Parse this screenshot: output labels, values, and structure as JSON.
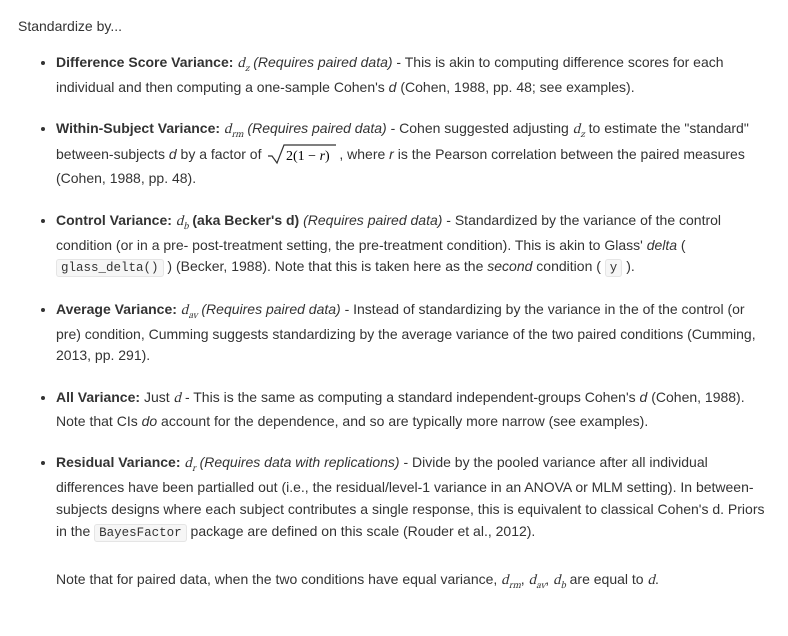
{
  "lead": "Standardize by...",
  "items": [
    {
      "title": "Difference Score Variance:",
      "symbol_html": "<span class='math'>d<span class='sub'>z</span></span>",
      "req": "(Requires paired data)",
      "body_html": " - This is akin to computing difference scores for each individual and then computing a one-sample Cohen's <em>d</em> (Cohen, 1988, pp. 48; see examples)."
    },
    {
      "title": "Within-Subject Variance:",
      "symbol_html": "<span class='math'>d<span class='sub'>rm</span></span>",
      "req": "(Requires paired data)",
      "body_html": " - Cohen suggested adjusting <span class='math'>d<span class='sub'>z</span></span> to estimate the &quot;standard&quot; between-subjects <em>d</em> by a factor of <span class='sqrt-wrap'><svg width='70' height='22' viewBox='0 0 70 22' style='vertical-align:-4px' xmlns='http://www.w3.org/2000/svg'><path d='M1 13 L5 13 L10 20 L17 2 L69 2' fill='none' stroke='#333' stroke-width='1.2'/><text x='19' y='17' font-family=\"Georgia,serif\" font-size='14'>2(1 − <tspan font-style='italic'>r</tspan>)</text></svg></span>, where <em>r</em> is the Pearson correlation between the paired measures (Cohen, 1988, pp. 48)."
    },
    {
      "title": "Control Variance:",
      "symbol_html": "<span class='math'>d<span class='sub'>b</span></span>",
      "aka": "(aka Becker's d)",
      "req": "(Requires paired data)",
      "body_html": " - Standardized by the variance of the control condition (or in a pre- post-treatment setting, the pre-treatment condition). This is akin to Glass' <em>delta</em> ( <code>glass_delta()</code> ) (Becker, 1988). Note that this is taken here as the <em>second</em> condition ( <code>y</code> )."
    },
    {
      "title": "Average Variance:",
      "symbol_html": "<span class='math'>d<span class='sub'>av</span></span>",
      "req": "(Requires paired data)",
      "body_html": " - Instead of standardizing by the variance in the of the control (or pre) condition, Cumming suggests standardizing by the average variance of the two paired conditions (Cumming, 2013, pp. 291)."
    },
    {
      "title": "All Variance:",
      "prefix": "Just ",
      "symbol_html": "<span class='math'>d</span>",
      "body_html": " - This is the same as computing a standard independent-groups Cohen's <em>d</em> (Cohen, 1988). Note that CIs <em>do</em> account for the dependence, and so are typically more narrow (see examples)."
    },
    {
      "title": "Residual Variance:",
      "symbol_html": "<span class='math'>d<span class='sub'>r</span></span>",
      "req": "(Requires data with replications)",
      "body_html": " - Divide by the pooled variance after all individual differences have been partialled out (i.e., the residual/level-1 variance in an ANOVA or MLM setting). In between-subjects designs where each subject contributes a single response, this is equivalent to classical Cohen's d. Priors in the <code>BayesFactor</code> package are defined on this scale (Rouder et al., 2012).",
      "note_html": "Note that for paired data, when the two conditions have equal variance, <span class='math'>d<span class='sub'>rm</span></span>, <span class='math'>d<span class='sub'>av</span></span>, <span class='math'>d<span class='sub'>b</span></span> are equal to <span class='math'>d</span>."
    }
  ]
}
